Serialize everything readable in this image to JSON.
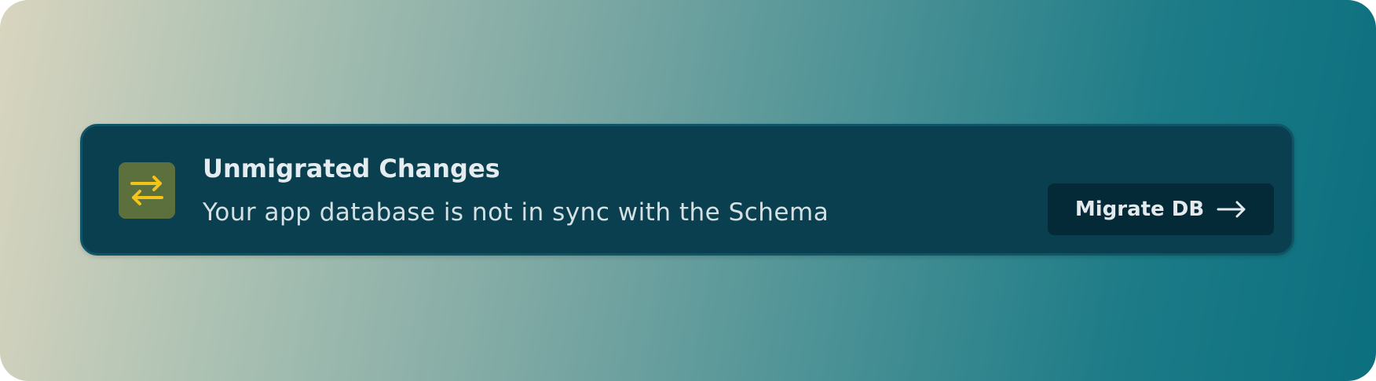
{
  "banner": {
    "icon": "swap-arrows-icon",
    "title": "Unmigrated Changes",
    "message": "Your app database is not in sync with the Schema",
    "action": {
      "label": "Migrate DB",
      "icon": "arrow-right-icon"
    }
  },
  "colors": {
    "banner_background": "#0a3f50",
    "icon_tile": "#5c703e",
    "icon_accent": "#f2c318",
    "button_background": "#052a37",
    "text_primary": "#e5ecef"
  }
}
